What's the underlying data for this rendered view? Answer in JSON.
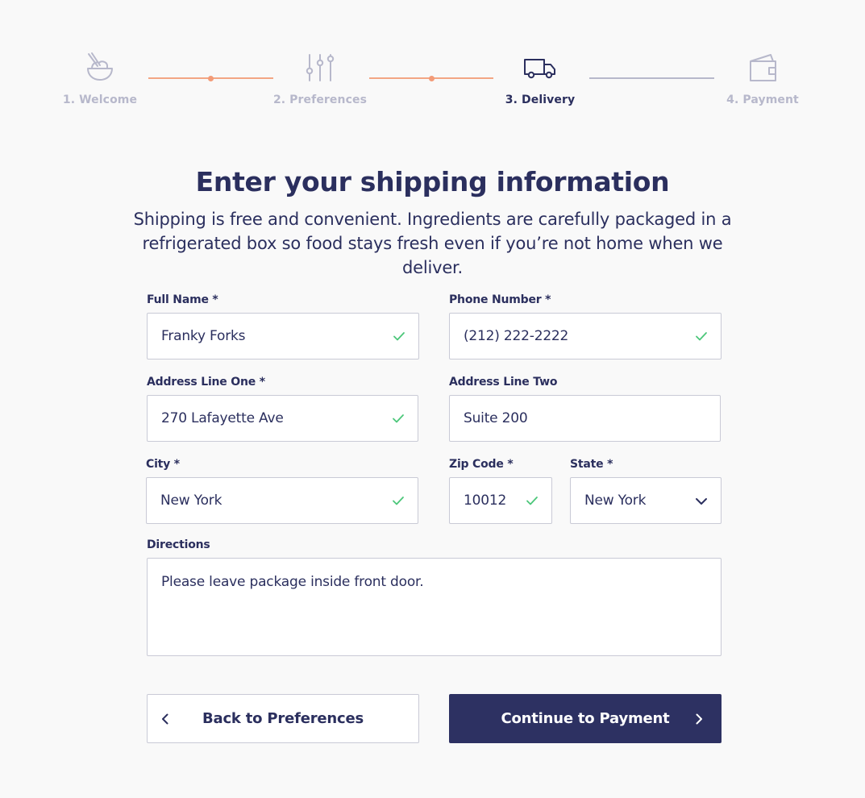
{
  "stepper": {
    "steps": [
      {
        "label": "1. Welcome",
        "icon": "bowl-icon",
        "state": "complete"
      },
      {
        "label": "2. Preferences",
        "icon": "sliders-icon",
        "state": "complete"
      },
      {
        "label": "3. Delivery",
        "icon": "truck-icon",
        "state": "active"
      },
      {
        "label": "4. Payment",
        "icon": "wallet-icon",
        "state": "upcoming"
      }
    ]
  },
  "header": {
    "title": "Enter your shipping information",
    "subtitle": "Shipping is free and convenient. Ingredients are carefully packaged in a refrigerated box so food stays fresh even if you’re not home when we deliver."
  },
  "form": {
    "full_name": {
      "label": "Full Name *",
      "value": "Franky Forks",
      "valid": true
    },
    "phone": {
      "label": "Phone Number *",
      "value": "(212) 222-2222",
      "valid": true
    },
    "address1": {
      "label": "Address Line One *",
      "value": "270 Lafayette Ave",
      "valid": true
    },
    "address2": {
      "label": "Address Line Two",
      "value": "Suite 200",
      "valid": false
    },
    "city": {
      "label": "City *",
      "value": "New York",
      "valid": true
    },
    "zip": {
      "label": "Zip Code *",
      "value": "10012",
      "valid": true
    },
    "state": {
      "label": "State *",
      "value": "New York"
    },
    "directions": {
      "label": "Directions",
      "value": "Please leave package inside front door."
    }
  },
  "buttons": {
    "back": "Back to Preferences",
    "next": "Continue to Payment"
  },
  "colors": {
    "primary": "#2d3162",
    "accent": "#f39b78",
    "valid": "#4cc77a",
    "muted": "#b7b8cb"
  }
}
